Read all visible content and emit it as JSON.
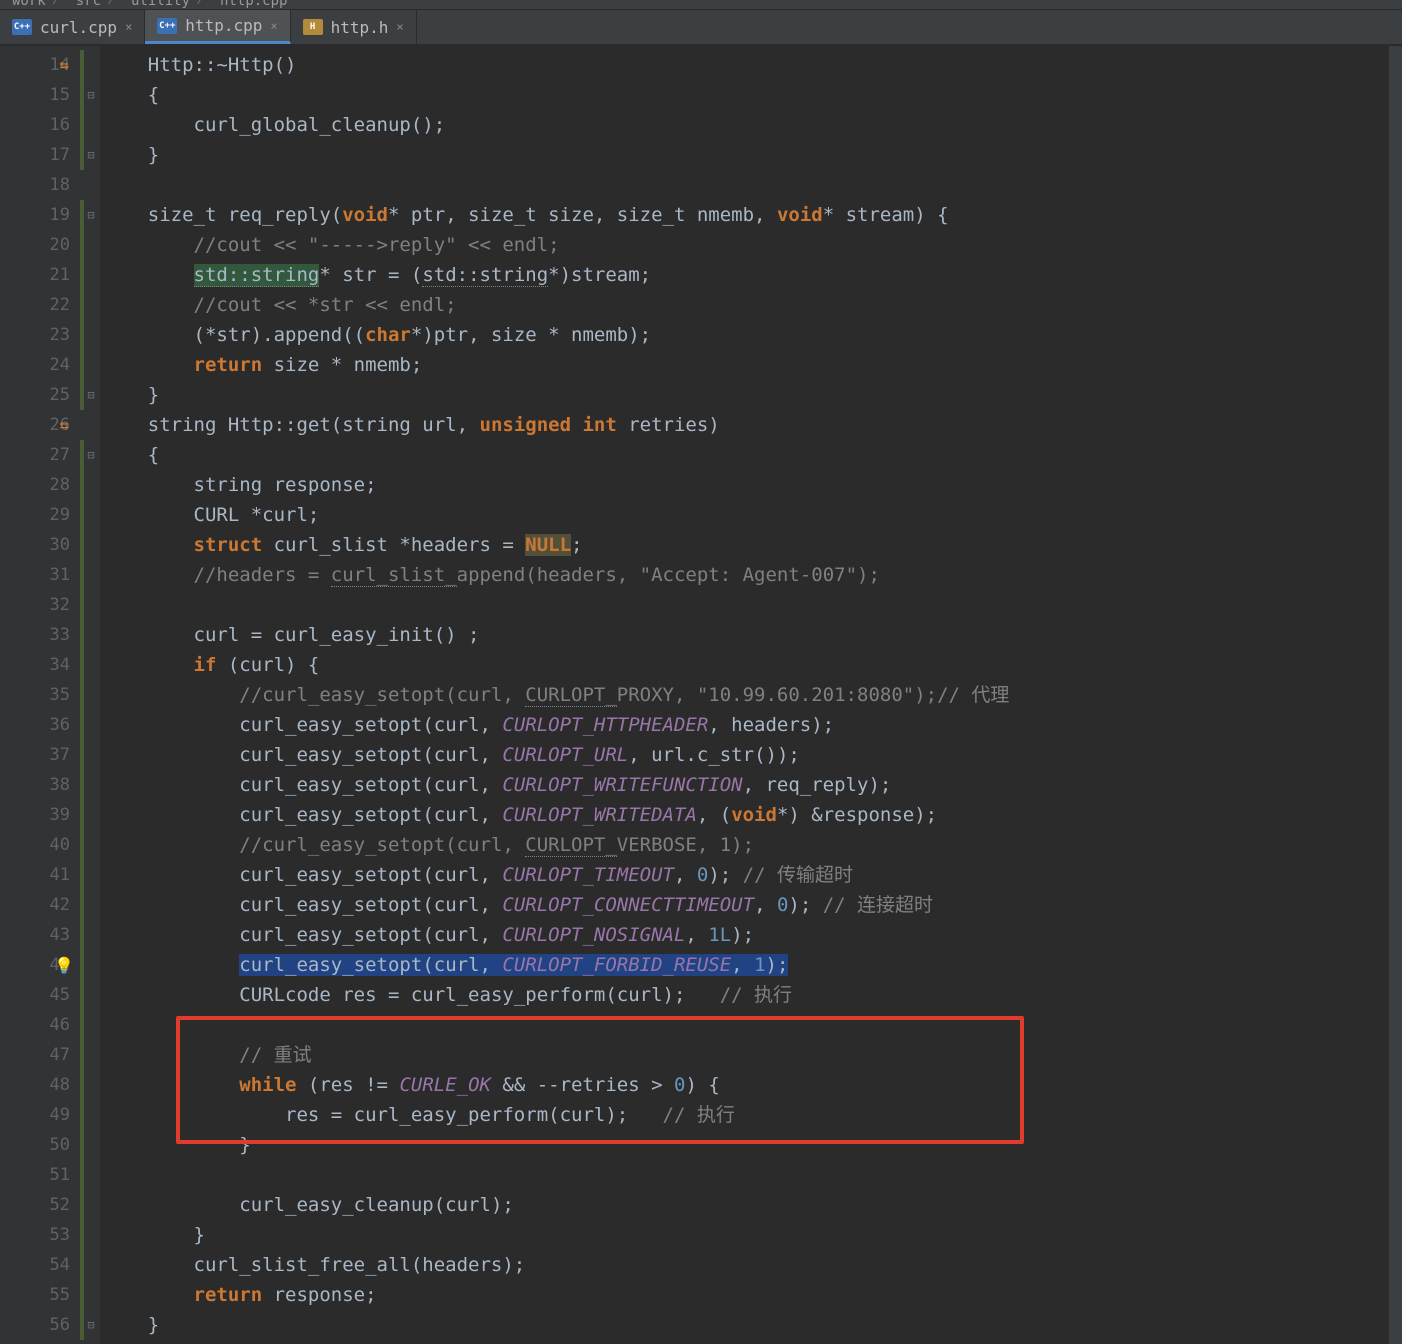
{
  "breadcrumbs": {
    "items": [
      "work",
      "src",
      "utility",
      "http.cpp"
    ]
  },
  "tabs": [
    {
      "label": "curl.cpp",
      "kind": "cpp",
      "active": false
    },
    {
      "label": "http.cpp",
      "kind": "cpp",
      "active": true
    },
    {
      "label": "http.h",
      "kind": "h",
      "active": false
    }
  ],
  "gutter": {
    "start": 14,
    "end": 56
  },
  "code": {
    "l14": {
      "pre": "    ",
      "t1": "Http::~Http()"
    },
    "l15": {
      "pre": "    {"
    },
    "l16": {
      "pre": "        ",
      "f": "curl_global_cleanup",
      "t": "();"
    },
    "l17": {
      "pre": "    }"
    },
    "l18": {
      "pre": ""
    },
    "l19": {
      "pre": "    ",
      "t0": "size_t req_reply(",
      "k1": "void",
      "t1": "* ptr, size_t size, size_t nmemb, ",
      "k2": "void",
      "t2": "* stream) {"
    },
    "l20": {
      "pre": "        ",
      "c": "//cout << \"----->reply\" << endl;"
    },
    "l21": {
      "pre": "        ",
      "u": "std::string",
      "t": "* str = (",
      "u2": "std::string",
      "t2": "*)stream;"
    },
    "l22": {
      "pre": "        ",
      "c": "//cout << *str << endl;"
    },
    "l23": {
      "pre": "        ",
      "t0": "(*str).append((",
      "k": "char",
      "t1": "*)ptr, size * nmemb);"
    },
    "l24": {
      "pre": "        ",
      "k": "return",
      "t": " size * nmemb;"
    },
    "l25": {
      "pre": "    }"
    },
    "l26": {
      "pre": "    ",
      "t0": "string Http::get(string url, ",
      "k1": "unsigned int",
      "t1": " retries)"
    },
    "l27": {
      "pre": "    {"
    },
    "l28": {
      "pre": "        ",
      "t": "string response;"
    },
    "l29": {
      "pre": "        ",
      "t": "CURL *curl;"
    },
    "l30": {
      "pre": "        ",
      "k": "struct",
      "t0": " curl_slist *headers = ",
      "n": "NULL",
      "t1": ";"
    },
    "l31": {
      "pre": "        ",
      "c0": "//headers = ",
      "cu": "curl_slist_",
      "c1": "append(headers, \"Accept: Agent-007\");"
    },
    "l32": {
      "pre": ""
    },
    "l33": {
      "pre": "        ",
      "t": "curl = curl_easy_init() ;"
    },
    "l34": {
      "pre": "        ",
      "k": "if",
      "t": " (curl) {"
    },
    "l35": {
      "pre": "            ",
      "c0": "//curl_easy_setopt(curl, ",
      "cu": "CURLOPT_",
      "c1": "PROXY, \"10.99.60.201:8080\");// 代理"
    },
    "l36": {
      "pre": "            ",
      "f": "curl_easy_setopt",
      "t0": "(curl, ",
      "co": "CURLOPT_HTTPHEADER",
      "t1": ", headers);"
    },
    "l37": {
      "pre": "            ",
      "f": "curl_easy_setopt",
      "t0": "(curl, ",
      "co": "CURLOPT_URL",
      "t1": ", url.c_str());"
    },
    "l38": {
      "pre": "            ",
      "f": "curl_easy_setopt",
      "t0": "(curl, ",
      "co": "CURLOPT_WRITEFUNCTION",
      "t1": ", req_reply);"
    },
    "l39": {
      "pre": "            ",
      "f": "curl_easy_setopt",
      "t0": "(curl, ",
      "co": "CURLOPT_WRITEDATA",
      "t1": ", (",
      "k": "void",
      "t2": "*) &response);"
    },
    "l40": {
      "pre": "            ",
      "c0": "//curl_easy_setopt(curl, ",
      "cu": "CURLOPT_",
      "c1": "VERBOSE, 1);"
    },
    "l41": {
      "pre": "            ",
      "f": "curl_easy_setopt",
      "t0": "(curl, ",
      "co": "CURLOPT_TIMEOUT",
      "t1": ", ",
      "n": "0",
      "t2": "); ",
      "c": "// 传输超时"
    },
    "l42": {
      "pre": "            ",
      "f": "curl_easy_setopt",
      "t0": "(curl, ",
      "co": "CURLOPT_CONNECTTIMEOUT",
      "t1": ", ",
      "n": "0",
      "t2": "); ",
      "c": "// 连接超时"
    },
    "l43": {
      "pre": "            ",
      "f": "curl_easy_setopt",
      "t0": "(curl, ",
      "co": "CURLOPT_NOSIGNAL",
      "t1": ", ",
      "n": "1L",
      "t2": ");"
    },
    "l44": {
      "pre": "            ",
      "f": "curl_easy_setopt",
      "t0": "(curl, ",
      "co": "CURLOPT_FORBID_REUSE",
      "t1": ", ",
      "n": "1",
      "t2": ");"
    },
    "l45": {
      "pre": "            ",
      "t0": "CURLcode res = curl_easy_perform(curl);   ",
      "c": "// 执行"
    },
    "l46": {
      "pre": ""
    },
    "l47": {
      "pre": "            ",
      "c": "// 重试"
    },
    "l48": {
      "pre": "            ",
      "k": "while",
      "t0": " (res != ",
      "co": "CURLE_OK",
      "t1": " && --retries > ",
      "n": "0",
      "t2": ") {"
    },
    "l49": {
      "pre": "                ",
      "t0": "res = curl_easy_perform(curl);   ",
      "c": "// 执行"
    },
    "l50": {
      "pre": "            }"
    },
    "l51": {
      "pre": ""
    },
    "l52": {
      "pre": "            ",
      "t": "curl_easy_cleanup(curl);"
    },
    "l53": {
      "pre": "        }"
    },
    "l54": {
      "pre": "        ",
      "t": "curl_slist_free_all(headers);"
    },
    "l55": {
      "pre": "        ",
      "k": "return",
      "t": " response;"
    },
    "l56": {
      "pre": "    }"
    }
  },
  "icons": {
    "cpp": "C++",
    "h": "H",
    "close": "×",
    "fold_open": "⊟",
    "fold_close": "⊞",
    "bulb": "💡"
  }
}
